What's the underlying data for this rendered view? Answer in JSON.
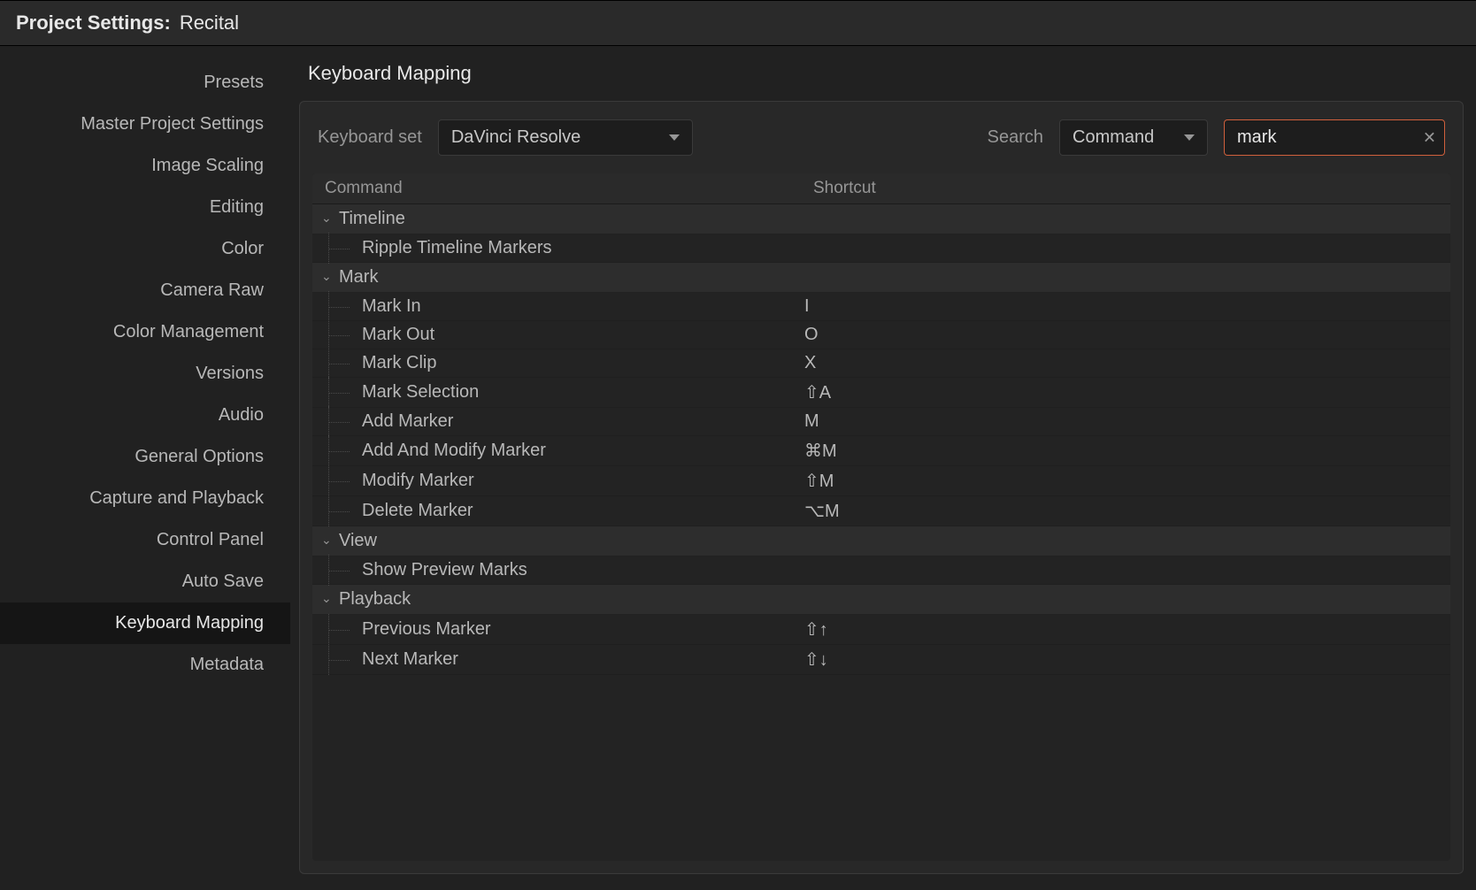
{
  "window": {
    "title": "Project Settings:",
    "project": "Recital"
  },
  "sidebar": {
    "items": [
      {
        "label": "Presets"
      },
      {
        "label": "Master Project Settings"
      },
      {
        "label": "Image Scaling"
      },
      {
        "label": "Editing"
      },
      {
        "label": "Color"
      },
      {
        "label": "Camera Raw"
      },
      {
        "label": "Color Management"
      },
      {
        "label": "Versions"
      },
      {
        "label": "Audio"
      },
      {
        "label": "General Options"
      },
      {
        "label": "Capture and Playback"
      },
      {
        "label": "Control Panel"
      },
      {
        "label": "Auto Save"
      },
      {
        "label": "Keyboard Mapping"
      },
      {
        "label": "Metadata"
      }
    ],
    "selected_index": 13
  },
  "main": {
    "title": "Keyboard Mapping",
    "toolbar": {
      "kbd_set_label": "Keyboard set",
      "kbd_set_value": "DaVinci Resolve",
      "search_label": "Search",
      "search_mode": "Command",
      "search_value": "mark"
    },
    "table": {
      "columns": {
        "command": "Command",
        "shortcut": "Shortcut"
      },
      "groups": [
        {
          "label": "Timeline",
          "items": [
            {
              "name": "Ripple Timeline Markers",
              "shortcut": ""
            }
          ]
        },
        {
          "label": "Mark",
          "items": [
            {
              "name": "Mark In",
              "shortcut": "I"
            },
            {
              "name": "Mark Out",
              "shortcut": "O"
            },
            {
              "name": "Mark Clip",
              "shortcut": "X"
            },
            {
              "name": "Mark Selection",
              "shortcut": "⇧A"
            },
            {
              "name": "Add Marker",
              "shortcut": "M"
            },
            {
              "name": "Add And Modify Marker",
              "shortcut": "⌘M"
            },
            {
              "name": "Modify Marker",
              "shortcut": "⇧M"
            },
            {
              "name": "Delete Marker",
              "shortcut": "⌥M"
            }
          ]
        },
        {
          "label": "View",
          "items": [
            {
              "name": "Show Preview Marks",
              "shortcut": ""
            }
          ]
        },
        {
          "label": "Playback",
          "items": [
            {
              "name": "Previous Marker",
              "shortcut": "⇧↑"
            },
            {
              "name": "Next Marker",
              "shortcut": "⇧↓"
            }
          ]
        }
      ]
    }
  }
}
